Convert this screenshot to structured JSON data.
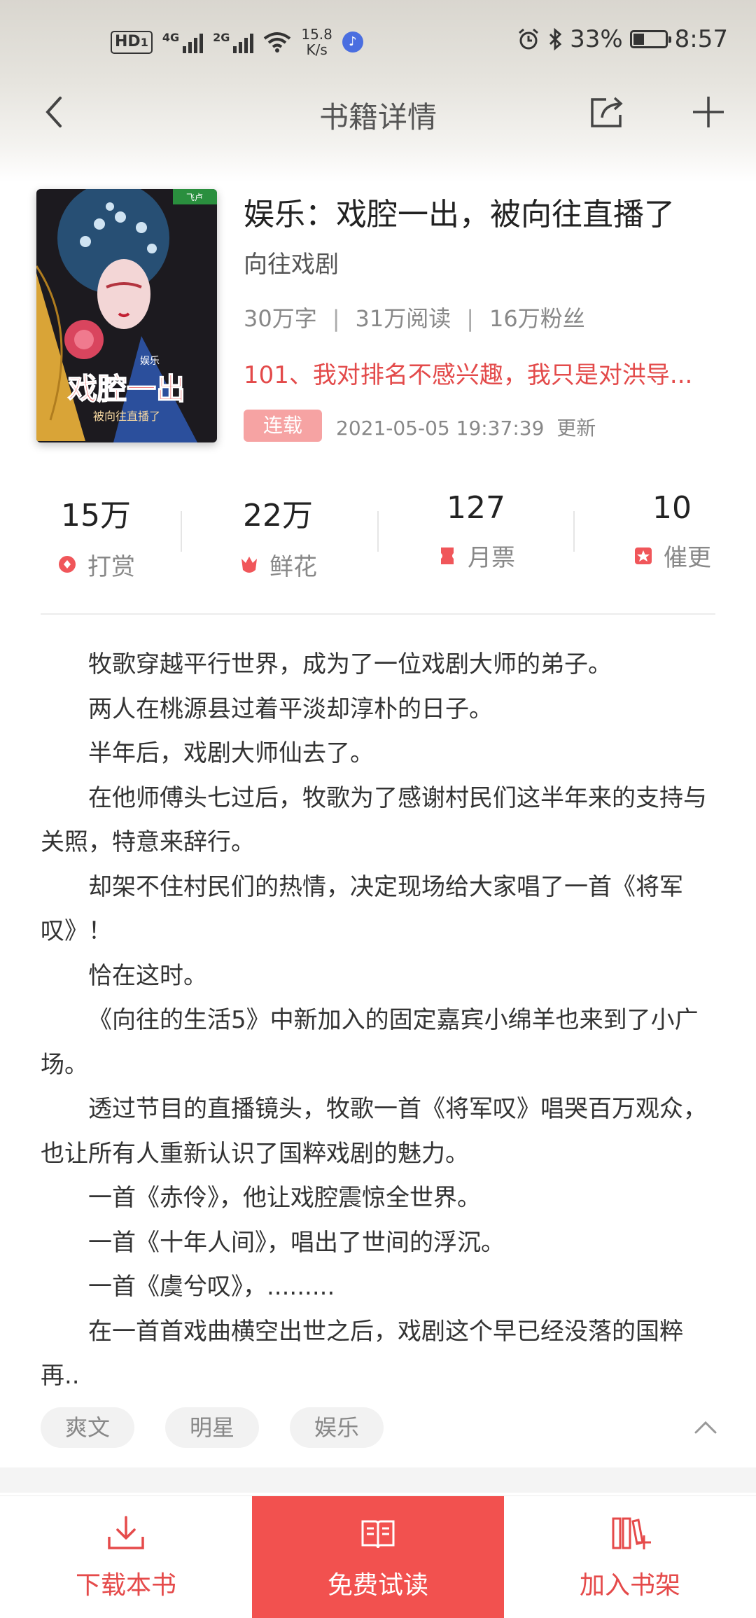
{
  "status_bar": {
    "hd_label": "HD",
    "hd_sub": "1",
    "network1": "4G",
    "network2": "2G",
    "speed": "15.8",
    "speed_unit": "K/s",
    "battery": "33%",
    "battery_level": 0.33,
    "time": "8:57"
  },
  "nav": {
    "title": "书籍详情"
  },
  "book": {
    "title": "娱乐：戏腔一出，被向往直播了",
    "author": "向往戏剧",
    "word_count": "30万字",
    "reads": "31万阅读",
    "fans": "16万粉丝",
    "stats_separator": "|",
    "latest_chapter": "101、我对排名不感兴趣，我只是对洪导...",
    "status_tag": "连载",
    "update_time": "2021-05-05 19:37:39",
    "update_label": "更新"
  },
  "metrics": [
    {
      "value": "15万",
      "label": "打赏",
      "icon": "reward-icon"
    },
    {
      "value": "22万",
      "label": "鲜花",
      "icon": "flower-icon"
    },
    {
      "value": "127",
      "label": "月票",
      "icon": "ticket-icon"
    },
    {
      "value": "10",
      "label": "催更",
      "icon": "urge-icon"
    }
  ],
  "synopsis": [
    "牧歌穿越平行世界，成为了一位戏剧大师的弟子。",
    "两人在桃源县过着平淡却淳朴的日子。",
    "半年后，戏剧大师仙去了。",
    "在他师傅头七过后，牧歌为了感谢村民们这半年来的支持与关照，特意来辞行。",
    "却架不住村民们的热情，决定现场给大家唱了一首《将军叹》！",
    "恰在这时。",
    "《向往的生活5》中新加入的固定嘉宾小绵羊也来到了小广场。",
    "透过节目的直播镜头，牧歌一首《将军叹》唱哭百万观众，也让所有人重新认识了国粹戏剧的魅力。",
    "一首《赤伶》，他让戏腔震惊全世界。",
    "一首《十年人间》，唱出了世间的浮沉。",
    "一首《虞兮叹》，.........",
    "在一首首戏曲横空出世之后，戏剧这个早已经没落的国粹再.."
  ],
  "tags": [
    "爽文",
    "明星",
    "娱乐"
  ],
  "bottom_bar": {
    "download": "下载本书",
    "read": "免费试读",
    "add_shelf": "加入书架"
  },
  "colors": {
    "accent_red": "#e54a4a",
    "button_fill": "#f2514f",
    "status_tag": "#f6a3a3"
  },
  "cover": {
    "small_tag": "娱乐",
    "title": "戏腔一出",
    "subtitle": "被向往直播了"
  }
}
